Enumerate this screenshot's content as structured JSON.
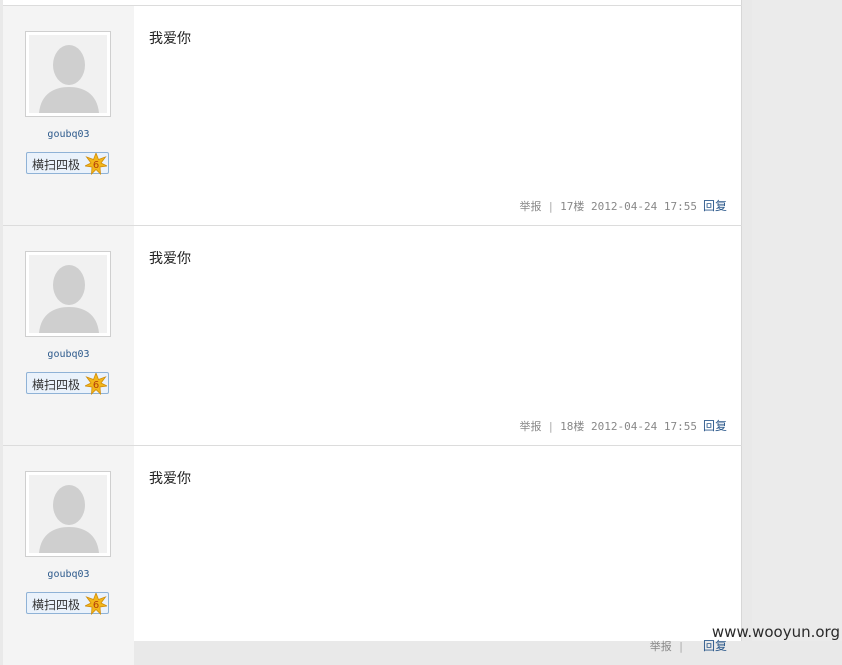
{
  "posts": [
    {
      "username": "goubq03",
      "rank": "横扫四极",
      "rank_level": "6",
      "content": "我爱你",
      "report": "举报",
      "floor": "17楼",
      "datetime": "2012-04-24 17:55",
      "reply": "回复"
    },
    {
      "username": "goubq03",
      "rank": "横扫四极",
      "rank_level": "6",
      "content": "我爱你",
      "report": "举报",
      "floor": "18楼",
      "datetime": "2012-04-24 17:55",
      "reply": "回复"
    },
    {
      "username": "goubq03",
      "rank": "横扫四极",
      "rank_level": "6",
      "content": "我爱你",
      "report": "举报",
      "floor": "",
      "datetime": "",
      "reply": "回复"
    }
  ],
  "watermark": "www.wooyun.org",
  "icons": {
    "avatar": "default-avatar-icon",
    "rank": "star-icon"
  }
}
